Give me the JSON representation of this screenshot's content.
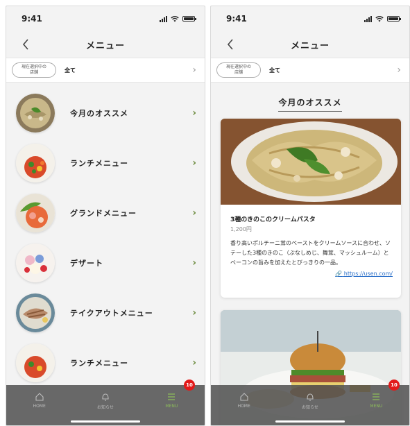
{
  "status": {
    "time": "9:41"
  },
  "nav": {
    "title": "メニュー"
  },
  "filter": {
    "pill_line1": "現在選択中の",
    "pill_line2": "店舗",
    "value": "全て"
  },
  "menu": {
    "items": [
      {
        "label": "今月のオススメ"
      },
      {
        "label": "ランチメニュー"
      },
      {
        "label": "グランドメニュー"
      },
      {
        "label": "デザート"
      },
      {
        "label": "テイクアウトメニュー"
      },
      {
        "label": "ランチメニュー"
      }
    ]
  },
  "tabs": [
    {
      "label": "HOME",
      "icon": "home-icon"
    },
    {
      "label": "お知らせ",
      "icon": "bell-icon"
    },
    {
      "label": "MENU",
      "icon": "menu-icon"
    }
  ],
  "badge": {
    "count": "10"
  },
  "detail": {
    "section_title": "今月のオススメ",
    "card": {
      "name": "3種のきのこのクリームパスタ",
      "price": "1,200円",
      "description": "香り高いポルチーニ茸のペーストをクリームソースに合わせ、ソテーした3種のきのこ（ぶなしめじ、舞茸、マッシュルーム）とベーコンの旨みを加えたとびっきりの一品。",
      "link": "https://usen.com/"
    }
  },
  "colors": {
    "accent": "#6a8a3c",
    "tab_active": "#8dbd5a",
    "badge": "#e21a1a",
    "link": "#2a6fc9"
  }
}
